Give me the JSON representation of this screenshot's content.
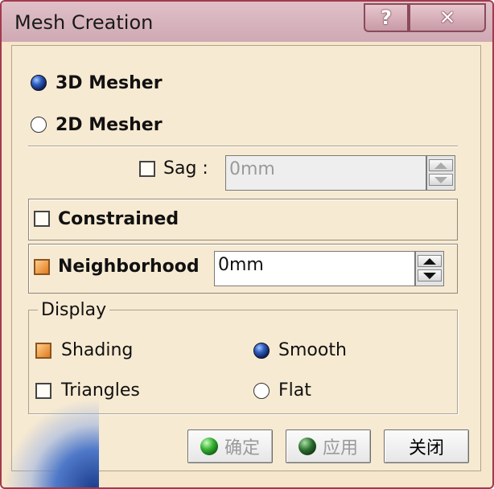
{
  "window": {
    "title": "Mesh Creation",
    "help_label": "?",
    "close_label": "✕"
  },
  "mesher": {
    "option_3d": "3D Mesher",
    "option_2d": "2D Mesher",
    "selected": "3D Mesher"
  },
  "sag": {
    "label": "Sag :",
    "value": "0mm",
    "checked": false,
    "enabled": false
  },
  "constrained": {
    "label": "Constrained",
    "checked": false
  },
  "neighborhood": {
    "label": "Neighborhood",
    "value": "0mm",
    "checked": true
  },
  "display": {
    "legend": "Display",
    "shading_label": "Shading",
    "shading_checked": true,
    "triangles_label": "Triangles",
    "triangles_checked": false,
    "smooth_label": "Smooth",
    "flat_label": "Flat",
    "selected": "Smooth"
  },
  "buttons": {
    "ok": "确定",
    "apply": "应用",
    "close": "关闭"
  },
  "colors": {
    "accent": "#f5e6cc",
    "title_bar": "#cfa9b3",
    "window_border": "#a23a4e"
  }
}
